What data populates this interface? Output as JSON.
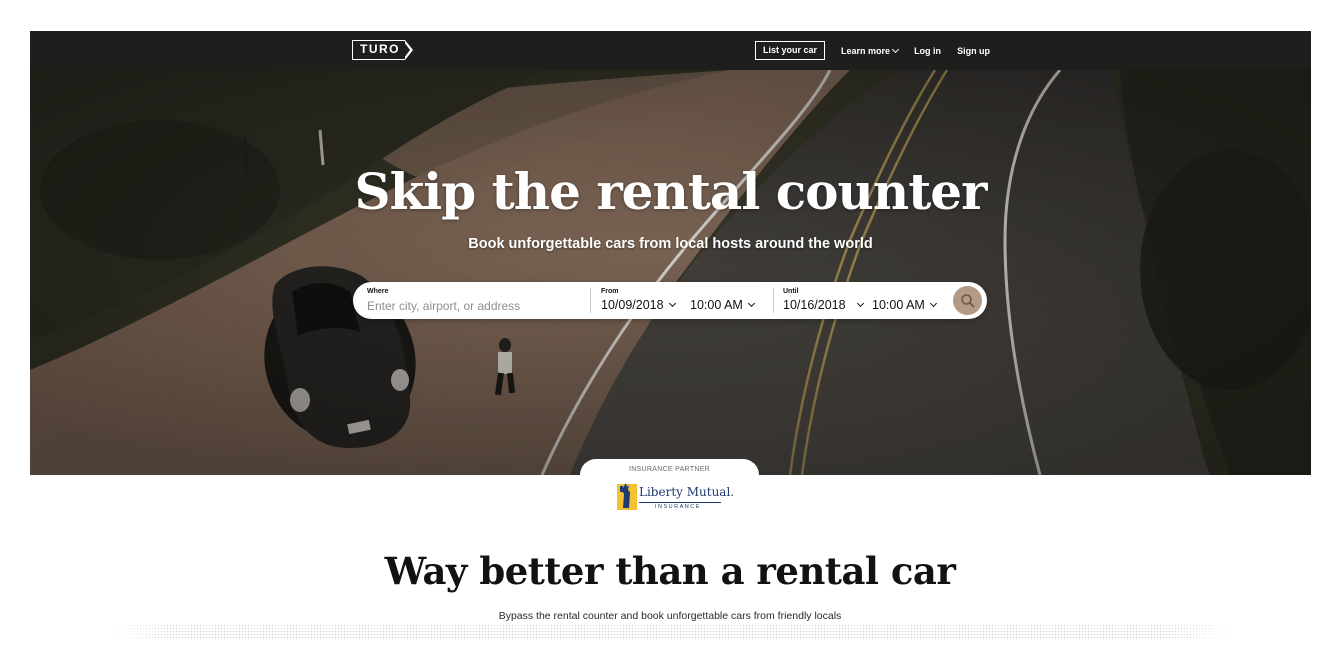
{
  "nav": {
    "logo_text": "TURO",
    "list_car": "List your car",
    "learn_more": "Learn more",
    "log_in": "Log in",
    "sign_up": "Sign up"
  },
  "hero": {
    "title": "Skip the rental counter",
    "subtitle": "Book unforgettable cars from local hosts around the world",
    "plate_text": "TM-RESD"
  },
  "search": {
    "where_label": "Where",
    "where_placeholder": "Enter city, airport, or address",
    "where_value": "",
    "from_label": "From",
    "from_date": "10/09/2018",
    "from_time": "10:00 AM",
    "until_label": "Until",
    "until_date": "10/16/2018",
    "until_time": "10:00 AM",
    "search_icon": "search-icon"
  },
  "insurance": {
    "label": "INSURANCE PARTNER",
    "partner_name": "Liberty Mutual.",
    "partner_sub": "INSURANCE"
  },
  "section": {
    "title": "Way better than a rental car",
    "subtitle": "Bypass the rental counter and book unforgettable cars from friendly locals"
  },
  "colors": {
    "nav_bg": "#1e1e1c",
    "search_button": "#b39a86",
    "text_dark": "#121214",
    "partner_blue": "#1f3a6e"
  }
}
